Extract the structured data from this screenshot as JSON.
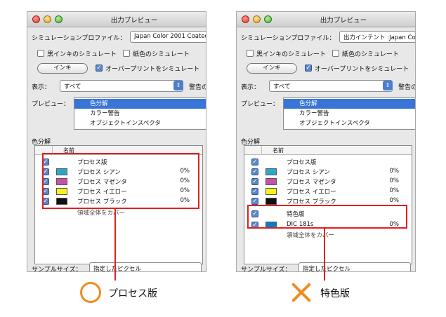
{
  "colors": {
    "accent": "#3875d7",
    "highlight_red": "#e02020",
    "mark_orange": "#f08c1f"
  },
  "left_window": {
    "title": "出力プレビュー",
    "simulation_profile_label": "シミュレーションプロファイル：",
    "simulation_profile_value": "Japan Color 2001 Coated",
    "simulate_black_ink": "黒インキのシミュレート",
    "simulate_paper_color": "紙色のシミュレート",
    "ink_button": "インキ",
    "simulate_overprint": "オーバープリントをシミュレート",
    "show_label": "表示：",
    "show_value": "すべて",
    "warning_text": "警告の",
    "preview_label": "プレビュー：",
    "preview_items": [
      "色分解",
      "カラー警告",
      "オブジェクトインスペクタ"
    ],
    "separations_label": "色分解",
    "column_name": "名前",
    "rows": [
      {
        "name": "プロセス版",
        "pct": "",
        "swatch": ""
      },
      {
        "name": "プロセス シアン",
        "pct": "0%",
        "swatch": "#29a9c9"
      },
      {
        "name": "プロセス マゼンタ",
        "pct": "0%",
        "swatch": "#c94fa8"
      },
      {
        "name": "プロセス イエロー",
        "pct": "0%",
        "swatch": "#f6f21c"
      },
      {
        "name": "プロセス ブラック",
        "pct": "0%",
        "swatch": "#111111"
      }
    ],
    "partial_row": "領域全体をカバー",
    "sample_size": "サンプルサイズ：",
    "sample_value": "指定したピクセル"
  },
  "right_window": {
    "title": "出力プレビュー",
    "simulation_profile_label": "シミュレーションプロファイル：",
    "simulation_profile_value": "出力インテント :Japan Colo",
    "simulate_black_ink": "黒インキのシミュレート",
    "simulate_paper_color": "紙色のシミュレート",
    "ink_button": "インキ",
    "simulate_overprint": "オーバープリントをシミュレート",
    "show_label": "表示：",
    "show_value": "すべて",
    "warning_text": "警告の",
    "preview_label": "プレビュー：",
    "preview_items": [
      "色分解",
      "カラー警告",
      "オブジェクトインスペクタ"
    ],
    "separations_label": "色分解",
    "column_name": "名前",
    "rows": [
      {
        "name": "プロセス版",
        "pct": "",
        "swatch": ""
      },
      {
        "name": "プロセス シアン",
        "pct": "0%",
        "swatch": "#29a9c9"
      },
      {
        "name": "プロセス マゼンタ",
        "pct": "0%",
        "swatch": "#c94fa8"
      },
      {
        "name": "プロセス イエロー",
        "pct": "0%",
        "swatch": "#f6f21c"
      },
      {
        "name": "プロセス ブラック",
        "pct": "0%",
        "swatch": "#111111"
      },
      {
        "name": "特色版",
        "pct": "",
        "swatch": ""
      },
      {
        "name": "DIC 181s",
        "pct": "0%",
        "swatch": "#0a7cc4"
      }
    ],
    "partial_row": "領域全体をカバー",
    "sample_size": "サンプルサイズ：",
    "sample_value": "指定したピクセル"
  },
  "captions": {
    "ok": "プロセス版",
    "ng": "特色版"
  }
}
